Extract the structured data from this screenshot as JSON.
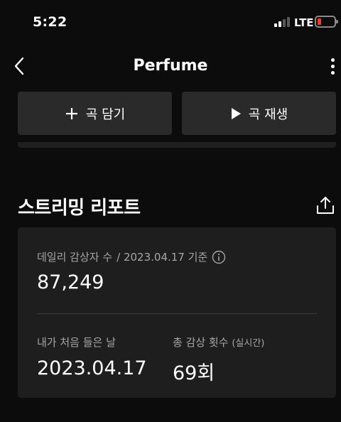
{
  "status_bar": {
    "time": "5:22",
    "network": "LTE",
    "signal_bars_active": 2,
    "signal_bars_total": 4,
    "battery_color": "#ff3b30"
  },
  "nav": {
    "back_icon": "chevron-left-icon",
    "title": "Perfume",
    "more_icon": "more-vertical-icon"
  },
  "actions": {
    "add_label": "곡 담기",
    "add_icon": "plus-icon",
    "play_label": "곡 재생",
    "play_icon": "play-icon",
    "button_bg": "#2a2a2a"
  },
  "report": {
    "title": "스트리밍 리포트",
    "share_icon": "share-icon",
    "daily_listeners_label": "데일리 감상자 수",
    "daily_listeners_date": "/ 2023.04.17 기준",
    "info_icon": "info-icon",
    "daily_listeners_value": "87,249",
    "first_listen_label": "내가 처음 들은 날",
    "first_listen_value": "2023.04.17",
    "total_plays_label": "총 감상 횟수",
    "total_plays_sub": "(실시간)",
    "total_plays_value": "69회",
    "card_bg": "#1e1e1e"
  }
}
